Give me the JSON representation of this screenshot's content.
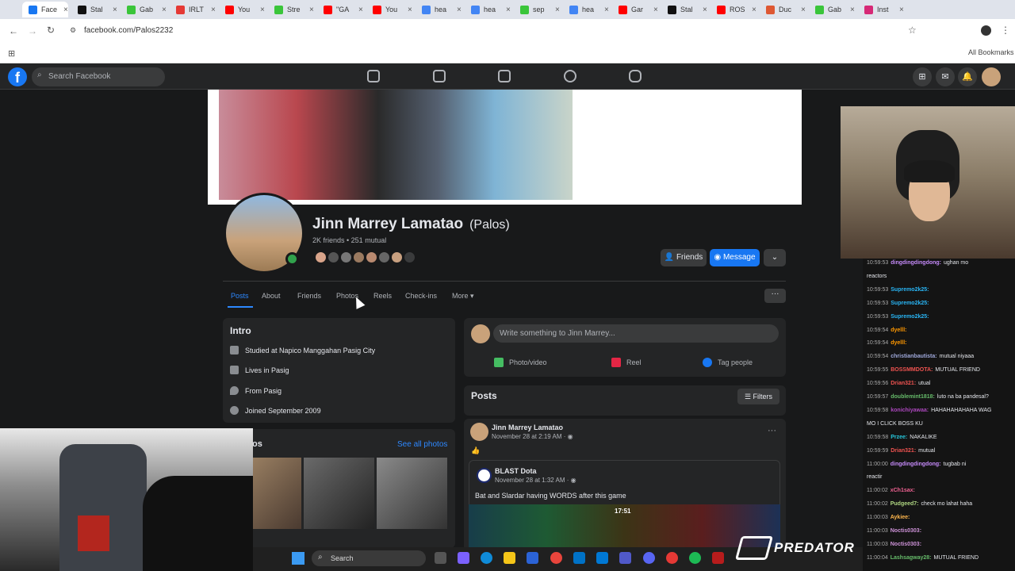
{
  "browser": {
    "tabs": [
      {
        "label": "Face",
        "color": "#1877f2"
      },
      {
        "label": "Stal",
        "color": "#111111"
      },
      {
        "label": "Gab",
        "color": "#3ac53a"
      },
      {
        "label": "IRLT",
        "color": "#e53935"
      },
      {
        "label": "You",
        "color": "#ff0000"
      },
      {
        "label": "Stre",
        "color": "#3ac53a"
      },
      {
        "label": "\"GA",
        "color": "#ff0000"
      },
      {
        "label": "You",
        "color": "#ff0000"
      },
      {
        "label": "hea",
        "color": "#4285f4"
      },
      {
        "label": "hea",
        "color": "#4285f4"
      },
      {
        "label": "sep",
        "color": "#3ac53a"
      },
      {
        "label": "hea",
        "color": "#4285f4"
      },
      {
        "label": "Gar",
        "color": "#ff0000"
      },
      {
        "label": "Stal",
        "color": "#111111"
      },
      {
        "label": "ROS",
        "color": "#ff0000"
      },
      {
        "label": "Duc",
        "color": "#de5833"
      },
      {
        "label": "Gab",
        "color": "#3ac53a"
      },
      {
        "label": "Inst",
        "color": "#d62976"
      }
    ],
    "url": "facebook.com/Palos2232",
    "bookmarks_label": "All Bookmarks"
  },
  "fbnav": {
    "logo": "f",
    "search_placeholder": "Search Facebook"
  },
  "profile": {
    "name": "Jinn Marrey Lamatao",
    "alias": "(Palos)",
    "stats": "2K friends • 251 mutual",
    "friends_button": "Friends",
    "message_button": "Message",
    "more_button": "⌄"
  },
  "profile_tabs": [
    "Posts",
    "About",
    "Friends",
    "Photos",
    "Reels",
    "Check-ins",
    "More ▾"
  ],
  "intro": {
    "title": "Intro",
    "items": [
      "Studied at Napico Manggahan Pasig City",
      "Lives in Pasig",
      "From Pasig",
      "Joined September 2009"
    ]
  },
  "photos": {
    "title": "os",
    "see_all": "See all photos"
  },
  "composer": {
    "placeholder": "Write something to Jinn Marrey...",
    "actions": [
      "Photo/video",
      "Reel",
      "Tag people"
    ]
  },
  "posts": {
    "title": "Posts",
    "filters": "Filters",
    "post": {
      "author": "Jinn Marrey Lamatao",
      "time": "November 28 at 2:19 AM · ◉",
      "shared_author": "BLAST Dota",
      "shared_time": "November 28 at 1:32 AM · ◉",
      "shared_text": "Bat and Slardar having WORDS after this game",
      "game_clock": "17:51"
    }
  },
  "chat": [
    {
      "t": "10:59:53",
      "u": "dingdingdingdong:",
      "m": "ughan mo",
      "c": "#c58af9"
    },
    {
      "t": "",
      "u": "",
      "m": "reactors",
      "c": "#e4e6eb"
    },
    {
      "t": "10:59:53",
      "u": "Supremo2k25:",
      "m": "",
      "c": "#29b6f6"
    },
    {
      "t": "10:59:53",
      "u": "Supremo2k25:",
      "m": "",
      "c": "#29b6f6"
    },
    {
      "t": "10:59:53",
      "u": "Supremo2k25:",
      "m": "",
      "c": "#29b6f6"
    },
    {
      "t": "10:59:54",
      "u": "dyelll:",
      "m": "",
      "c": "#ff9800"
    },
    {
      "t": "10:59:54",
      "u": "dyelll:",
      "m": "",
      "c": "#ff9800"
    },
    {
      "t": "10:59:54",
      "u": "christianbautista:",
      "m": "mutual niyaaa",
      "c": "#9fa8da"
    },
    {
      "t": "10:59:55",
      "u": "BOSSMMDOTA:",
      "m": "MUTUAL FRIEND",
      "c": "#ef5350"
    },
    {
      "t": "10:59:56",
      "u": "Drian321:",
      "m": "utual",
      "c": "#ef5350"
    },
    {
      "t": "10:59:57",
      "u": "doublemint1818:",
      "m": "luto na ba pandesal?",
      "c": "#66bb6a"
    },
    {
      "t": "10:59:58",
      "u": "konichiyawaa:",
      "m": "HAHAHAHAHAHA WAG",
      "c": "#ab47bc"
    },
    {
      "t": "",
      "u": "",
      "m": "MO I CLICK BOSS KU",
      "c": "#e4e6eb"
    },
    {
      "t": "10:59:58",
      "u": "Przee:",
      "m": "NAKALIKE",
      "c": "#26c6da"
    },
    {
      "t": "10:59:59",
      "u": "Drian321:",
      "m": "mutual",
      "c": "#ef5350"
    },
    {
      "t": "11:00:00",
      "u": "dingdingdingdong:",
      "m": "tugbab ni",
      "c": "#c58af9"
    },
    {
      "t": "",
      "u": "",
      "m": "reactir",
      "c": "#e4e6eb"
    },
    {
      "t": "11:00:02",
      "u": "xCh1sax:",
      "m": "",
      "c": "#f06292"
    },
    {
      "t": "11:00:02",
      "u": "Pudgeed7:",
      "m": "check mo lahat haha",
      "c": "#aed581"
    },
    {
      "t": "11:00:03",
      "u": "Aykiee:",
      "m": "",
      "c": "#ffb74d"
    },
    {
      "t": "11:00:03",
      "u": "Noctis0303:",
      "m": "",
      "c": "#ce93d8"
    },
    {
      "t": "11:00:03",
      "u": "Noctis0303:",
      "m": "",
      "c": "#ce93d8"
    },
    {
      "t": "11:00:04",
      "u": "Lashsagway28:",
      "m": "MUTUAL FRIEND",
      "c": "#66bb6a"
    }
  ],
  "taskbar": {
    "search_label": "Search",
    "brand": "PREDATOR"
  },
  "icons": [
    "back-icon",
    "forward-icon",
    "reload-icon",
    "home-icon",
    "video-icon",
    "marketplace-icon",
    "groups-icon",
    "gaming-icon",
    "menu-grid-icon",
    "messenger-icon",
    "bell-icon"
  ]
}
